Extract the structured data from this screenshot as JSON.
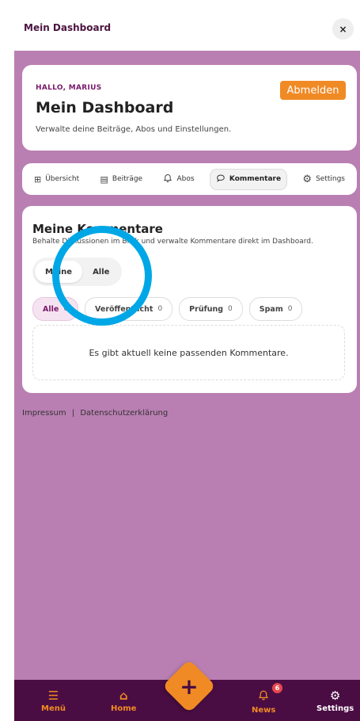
{
  "window": {
    "title": "Mein Dashboard",
    "close_label": "×"
  },
  "header": {
    "greeting": "HALLO, MARIUS",
    "logout_label": "Abmelden",
    "title": "Mein Dashboard",
    "subtitle": "Verwalte deine Beiträge, Abos und Einstellungen."
  },
  "tabs": [
    {
      "label": "Übersicht",
      "icon": "grid-icon"
    },
    {
      "label": "Beiträge",
      "icon": "document-icon"
    },
    {
      "label": "Abos",
      "icon": "bell-icon"
    },
    {
      "label": "Kommentare",
      "icon": "chat-icon",
      "active": true
    },
    {
      "label": "Settings",
      "icon": "gear-icon"
    }
  ],
  "comments": {
    "title": "Meine Kommentare",
    "subtitle": "Behalte Diskussionen im Blick und verwalte Kommentare direkt im Dashboard.",
    "segments": [
      "Meine",
      "Alle"
    ],
    "filters": [
      {
        "label": "Alle",
        "count": "0"
      },
      {
        "label": "Veröffentlicht",
        "count": "0"
      },
      {
        "label": "Prüfung",
        "count": "0"
      },
      {
        "label": "Spam",
        "count": "0"
      }
    ],
    "empty_text": "Es gibt aktuell keine passenden Kommentare."
  },
  "footer": {
    "impressum": "Impressum",
    "separator": "|",
    "privacy": "Datenschutzerklärung"
  },
  "bottom_nav": {
    "menu": "Menü",
    "home": "Home",
    "news": "News",
    "news_badge": "6",
    "settings": "Settings"
  },
  "colors": {
    "accent": "#f08a24",
    "brand": "#4a0d43",
    "background": "#b97fb2",
    "highlight_circle": "#00a7e6"
  }
}
